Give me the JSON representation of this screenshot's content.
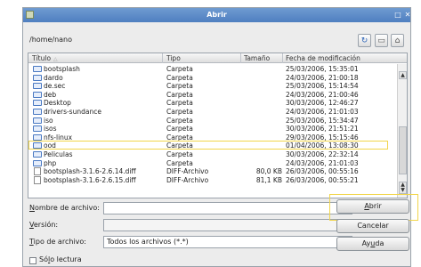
{
  "window": {
    "title": "Abrir"
  },
  "toolbar": {
    "path": "/home/nano"
  },
  "columns": {
    "name": "Título",
    "type": "Tipo",
    "size": "Tamaño",
    "date": "Fecha de modificación"
  },
  "rows": [
    {
      "name": "bootsplash",
      "type": "Carpeta",
      "size": "",
      "date": "25/03/2006, 15:35:01",
      "icon": "folder-icon"
    },
    {
      "name": "dardo",
      "type": "Carpeta",
      "size": "",
      "date": "24/03/2006, 21:00:18",
      "icon": "folder-icon"
    },
    {
      "name": "de.sec",
      "type": "Carpeta",
      "size": "",
      "date": "25/03/2006, 15:14:54",
      "icon": "folder-icon"
    },
    {
      "name": "deb",
      "type": "Carpeta",
      "size": "",
      "date": "24/03/2006, 21:00:46",
      "icon": "folder-icon"
    },
    {
      "name": "Desktop",
      "type": "Carpeta",
      "size": "",
      "date": "30/03/2006, 12:46:27",
      "icon": "folder-icon"
    },
    {
      "name": "drivers-sundance",
      "type": "Carpeta",
      "size": "",
      "date": "24/03/2006, 21:01:03",
      "icon": "folder-icon"
    },
    {
      "name": "iso",
      "type": "Carpeta",
      "size": "",
      "date": "25/03/2006, 15:34:47",
      "icon": "folder-icon"
    },
    {
      "name": "isos",
      "type": "Carpeta",
      "size": "",
      "date": "30/03/2006, 21:51:21",
      "icon": "folder-icon"
    },
    {
      "name": "nfs-linux",
      "type": "Carpeta",
      "size": "",
      "date": "29/03/2006, 15:15:46",
      "icon": "folder-icon"
    },
    {
      "name": "ood",
      "type": "Carpeta",
      "size": "",
      "date": "01/04/2006, 13:08:30",
      "icon": "folder-icon"
    },
    {
      "name": "Peliculas",
      "type": "Carpeta",
      "size": "",
      "date": "30/03/2006, 22:32:14",
      "icon": "folder-icon"
    },
    {
      "name": "php",
      "type": "Carpeta",
      "size": "",
      "date": "24/03/2006, 21:01:03",
      "icon": "folder-icon"
    },
    {
      "name": "bootsplash-3.1.6-2.6.14.diff",
      "type": "DIFF-Archivo",
      "size": "80,0 KB",
      "date": "26/03/2006, 00:55:16",
      "icon": "file-icon"
    },
    {
      "name": "bootsplash-3.1.6-2.6.15.diff",
      "type": "DIFF-Archivo",
      "size": "81,1 KB",
      "date": "26/03/2006, 00:55:21",
      "icon": "file-icon"
    }
  ],
  "form": {
    "filename_label": "Nombre de archivo:",
    "filename_value": "",
    "version_label": "Versión:",
    "version_value": "",
    "filetype_label": "Tipo de archivo:",
    "filetype_value": "Todos los archivos (*.*)",
    "readonly_label": "Sólo lectura"
  },
  "buttons": {
    "open": "Abrir",
    "cancel": "Cancelar",
    "help": "Ayuda"
  },
  "colors": {
    "titlebar": "#5a88c6",
    "highlight": "#f1d54b",
    "folder": "#4878c2"
  }
}
